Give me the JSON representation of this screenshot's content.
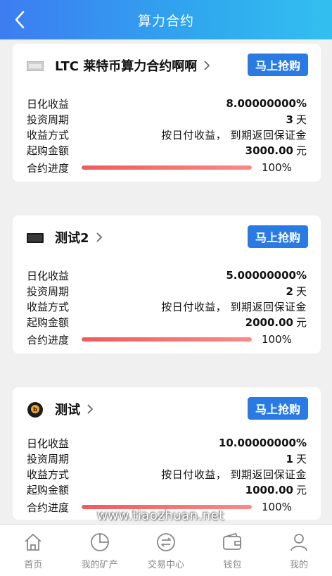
{
  "header": {
    "title": "算力合约"
  },
  "buy_label": "马上抢购",
  "labels": {
    "daily_yield": "日化收益",
    "period": "投资周期",
    "method": "收益方式",
    "min_amount": "起购金额",
    "progress": "合约进度"
  },
  "cards": [
    {
      "name": "LTC 莱特币算力合约啊啊",
      "icon": "litecoin-logo-icon",
      "daily_yield": "8.00000000%",
      "period_value": "3",
      "period_unit": "天",
      "method": "按日付收益， 到期返回保证金",
      "min_amount": "3000.00",
      "min_unit": "元",
      "progress_text": "100%",
      "progress": 1.0
    },
    {
      "name": "测试2",
      "icon": "card-logo-icon",
      "daily_yield": "5.00000000%",
      "period_value": "2",
      "period_unit": "天",
      "method": "按日付收益， 到期返回保证金",
      "min_amount": "2000.00",
      "min_unit": "元",
      "progress_text": "100%",
      "progress": 1.0
    },
    {
      "name": "测试",
      "icon": "bitcoin-logo-icon",
      "daily_yield": "10.00000000%",
      "period_value": "1",
      "period_unit": "天",
      "method": "按日付收益， 到期返回保证金",
      "min_amount": "1000.00",
      "min_unit": "元",
      "progress_text": "100%",
      "progress": 1.0
    }
  ],
  "watermark": "www.tiaozhuan.net",
  "tabs": [
    {
      "label": "首页",
      "icon": "home-icon"
    },
    {
      "label": "我的矿产",
      "icon": "pie-chart-icon"
    },
    {
      "label": "交易中心",
      "icon": "exchange-icon"
    },
    {
      "label": "钱包",
      "icon": "wallet-icon"
    },
    {
      "label": "我的",
      "icon": "user-icon"
    }
  ],
  "colors": {
    "header_start": "#3d7cf2",
    "header_end": "#33bff0",
    "button": "#2a7ae4",
    "progress": "#f25a5a"
  }
}
